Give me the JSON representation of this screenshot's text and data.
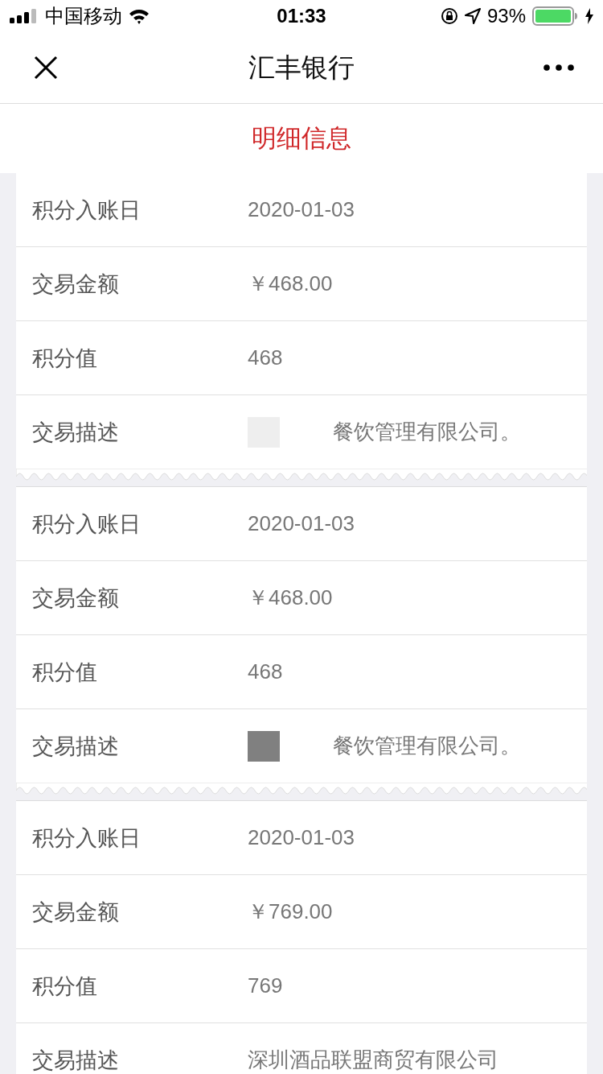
{
  "status_bar": {
    "carrier": "中国移动",
    "time": "01:33",
    "battery": "93%"
  },
  "nav": {
    "title": "汇丰银行"
  },
  "section": {
    "title": "明细信息"
  },
  "records": [
    {
      "rows": [
        {
          "label": "积分入账日",
          "value": "2020-01-03"
        },
        {
          "label": "交易金额",
          "value": "￥468.00"
        },
        {
          "label": "积分值",
          "value": "468"
        },
        {
          "label": "交易描述",
          "value": "餐饮管理有限公司。",
          "kind": "redacted"
        }
      ]
    },
    {
      "rows": [
        {
          "label": "积分入账日",
          "value": "2020-01-03"
        },
        {
          "label": "交易金额",
          "value": "￥468.00"
        },
        {
          "label": "积分值",
          "value": "468"
        },
        {
          "label": "交易描述",
          "value": "餐饮管理有限公司。",
          "kind": "redacted"
        }
      ]
    },
    {
      "rows": [
        {
          "label": "积分入账日",
          "value": "2020-01-03"
        },
        {
          "label": "交易金额",
          "value": "￥769.00"
        },
        {
          "label": "积分值",
          "value": "769"
        },
        {
          "label": "交易描述",
          "value": "深圳酒品联盟商贸有限公司",
          "kind": "plain"
        }
      ]
    }
  ]
}
